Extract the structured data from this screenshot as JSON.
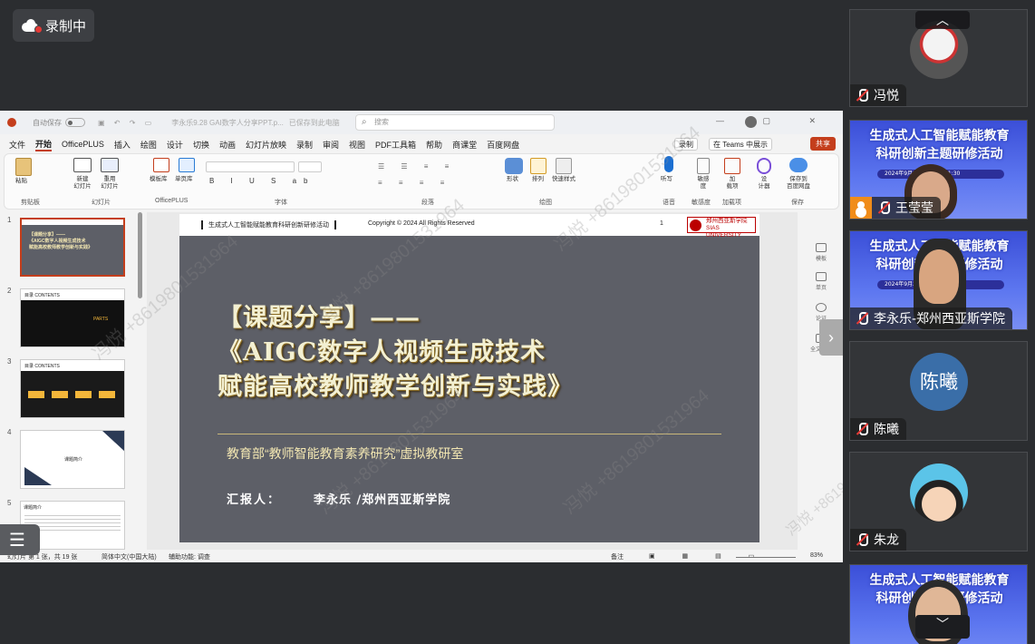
{
  "recording": {
    "label": "录制中"
  },
  "ppt": {
    "titlebar": {
      "autosave": "自动保存",
      "filename": "李永乐9.28 GAI数字人分享PPT.p...",
      "saved": "已保存到此电脑",
      "search_placeholder": "搜索"
    },
    "menu": [
      "文件",
      "开始",
      "OfficePLUS",
      "插入",
      "绘图",
      "设计",
      "切换",
      "动画",
      "幻灯片放映",
      "录制",
      "审阅",
      "视图",
      "PDF工具箱",
      "帮助",
      "商课堂",
      "百度网盘"
    ],
    "menu_right": {
      "record": "录制",
      "teams": "在 Teams 中展示",
      "share": "共享"
    },
    "ribbon_groups": [
      "剪贴板",
      "幻灯片",
      "OfficePLUS",
      "字体",
      "段落",
      "绘图",
      "语音",
      "敏感度",
      "加载项",
      "保存"
    ],
    "ribbon_labels": [
      "粘贴",
      "新建\n幻灯片",
      "重用\n幻灯片",
      "模板库",
      "单页库",
      "形状",
      "排列",
      "快速样式",
      "听写",
      "敏感\n度",
      "加\n载项",
      "设\n计器",
      "保存到\n百度网盘"
    ],
    "thumbnails": [
      {
        "num": "1",
        "lines": [
          "【课题分享】——",
          "《AIGC数字人视频生成技术",
          "赋能高校教师教学创新与实践》"
        ]
      },
      {
        "num": "2",
        "lines": [
          "目录 CONTENTS",
          "PARTS"
        ]
      },
      {
        "num": "3",
        "lines": [
          "目录 CONTENTS"
        ]
      },
      {
        "num": "4",
        "lines": [
          "课题简介"
        ]
      },
      {
        "num": "5",
        "lines": [
          "课题简介"
        ]
      }
    ],
    "slide": {
      "header_left": "生成式人工智能赋能教育科研创新研修活动",
      "header_copyright": "Copyright © 2024 All Rights Reserved",
      "header_page": "1",
      "header_logo": "郑州西亚斯学院",
      "header_logo_en": "SIAS UNIVERSITY",
      "title_line1": "【课题分享】——",
      "title_line2": "《AIGC数字人视频生成技术",
      "title_line3": "赋能高校教师教学创新与实践》",
      "subtitle": "教育部“教师智能教育素养研究”虚拟教研室",
      "reporter_label": "汇报人：",
      "reporter_name": "李永乐 /郑州西亚斯学院"
    },
    "right_pane": [
      "模板",
      "单页",
      "论证",
      "全文美化"
    ],
    "status": {
      "slide_info": "幻灯片 第 1 张，共 19 张",
      "language": "简体中文(中国大陆)",
      "accessibility": "辅助功能: 调查",
      "notes": "备注",
      "zoom": "83%"
    }
  },
  "watermark": "冯悦 +8619801531964",
  "participants": [
    {
      "name": "冯悦",
      "type": "avatar-photo",
      "mic": "muted"
    },
    {
      "name": "王莹莹",
      "type": "video-poster",
      "mic": "host",
      "poster_line1": "生成式人工智能赋能教育",
      "poster_line2": "科研创新主题研修活动",
      "poster_time": "2024年9月28日 19:30-21:30"
    },
    {
      "name": "李永乐-郑州西亚斯学院",
      "type": "video-poster",
      "mic": "muted",
      "poster_line1": "生成式人工智能赋能教育",
      "poster_line2": "科研创新主题研修活动",
      "poster_time": "2024年9月28日 19:30-21:30"
    },
    {
      "name": "陈曦",
      "type": "avatar-text",
      "initials": "陈曦",
      "mic": "muted",
      "color": "#3a6ea8"
    },
    {
      "name": "朱龙",
      "type": "avatar-cartoon",
      "mic": "muted"
    },
    {
      "name": "",
      "type": "video-poster",
      "mic": "none",
      "poster_line1": "生成式人工智能赋能教育",
      "poster_line2": "科研创新主题研修活动"
    }
  ],
  "colors": {
    "accent": "#c43e1c",
    "slide_bg": "#5d5f67",
    "poster": "#4a5fe0",
    "host": "#f08c1a"
  }
}
